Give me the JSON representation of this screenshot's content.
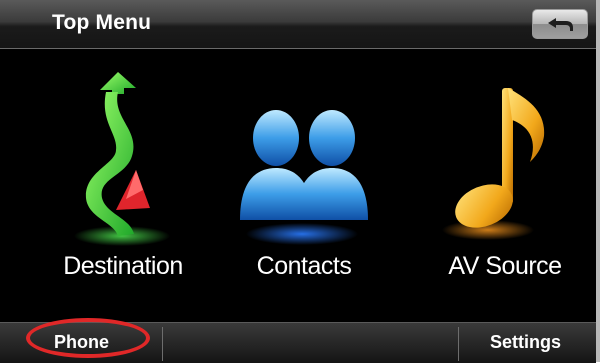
{
  "header": {
    "title": "Top Menu",
    "back_icon": "back-arrow-icon"
  },
  "menu": {
    "items": [
      {
        "label": "Destination",
        "icon": "route-arrow-icon"
      },
      {
        "label": "Contacts",
        "icon": "contacts-people-icon"
      },
      {
        "label": "AV Source",
        "icon": "music-note-icon"
      }
    ]
  },
  "bottom_bar": {
    "phone_label": "Phone",
    "settings_label": "Settings"
  },
  "annotation": {
    "highlight_color": "#e02828",
    "highlighted": "Phone"
  },
  "colors": {
    "background": "#000000",
    "text": "#ffffff"
  }
}
